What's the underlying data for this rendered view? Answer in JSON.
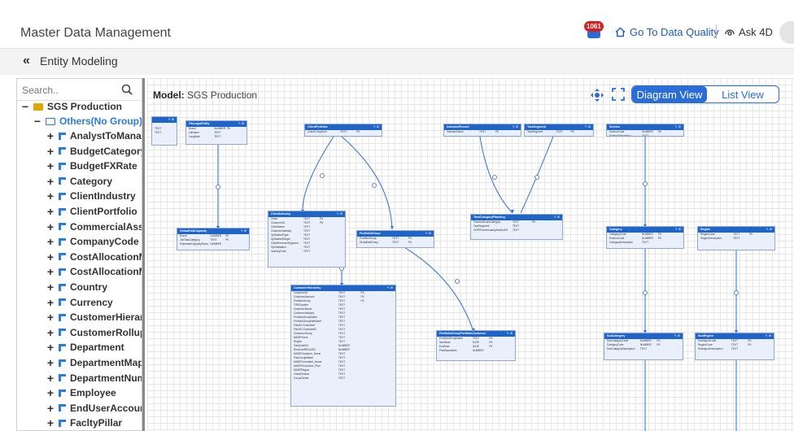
{
  "header": {
    "app_title": "Master Data Management",
    "notification_count": "1061",
    "data_quality_link": "Go To Data Quality",
    "ask_label": "Ask 4D"
  },
  "subheader": {
    "back_icon": "«",
    "title": "Entity Modeling"
  },
  "sidebar": {
    "search_placeholder": "Search..",
    "root_label": "SGS Production",
    "group_label": "Others(No Group)",
    "items": [
      "AnalystToManag",
      "BudgetCategory",
      "BudgetFXRate",
      "Category",
      "ClientIndustry",
      "ClientPortfolio",
      "CommercialAssi",
      "CompanyCode",
      "CostAllocationM",
      "CostAllocationM",
      "Country",
      "Currency",
      "CustomerHierar",
      "CustomerRollup",
      "Department",
      "DepartmentMap",
      "DepartmentNum",
      "Employee",
      "EndUserAccount",
      "FacltyPillar"
    ]
  },
  "canvas": {
    "model_prefix": "Model:",
    "model_name": "SGS Production",
    "view_active": "Diagram View",
    "view_inactive": "List View",
    "tables": [
      {
        "title": "",
        "rows": [
          [
            "",
            "",
            ""
          ],
          [
            "TEXT",
            "",
            ""
          ],
          [
            "TEXT",
            "",
            ""
          ]
        ]
      },
      {
        "title": "GfsLegalEntity",
        "rows": [
          [
            "Brand",
            "NUMBER",
            "PK"
          ],
          [
            "LatName",
            "TEXT",
            ""
          ],
          [
            "Longitude",
            "TEXT",
            ""
          ]
        ]
      },
      {
        "title": "ClientPortfolio",
        "rows": [
          [
            "ClientGroupNum",
            "TEXT",
            "PK"
          ],
          [
            "",
            "",
            ""
          ]
        ]
      },
      {
        "title": "IndicatorRecord",
        "rows": [
          [
            "IndicatorName",
            "TEXT",
            "PK"
          ],
          [
            "",
            "",
            ""
          ]
        ]
      },
      {
        "title": "TaskSegment",
        "rows": [
          [
            "TaskSegment",
            "TEXT",
            "PK"
          ],
          [
            "",
            "",
            ""
          ]
        ]
      },
      {
        "title": "Section",
        "rows": [
          [
            "SectionCode",
            "NUMBER",
            "PK"
          ],
          [
            "SectionDescription",
            "TEXT",
            ""
          ]
        ]
      },
      {
        "title": "GlobalHubCapacity",
        "rows": [
          [
            "Brand",
            "NUMBER",
            "PK"
          ],
          [
            "JobTaskCategory",
            "TEXT",
            "PK"
          ],
          [
            "EstimatedCapacityHours",
            "NUMBER",
            ""
          ]
        ]
      },
      {
        "title": "ClientIndustry",
        "rows": [
          [
            "Client",
            "TEXT",
            "PK"
          ],
          [
            "CustomerID",
            "TEXT",
            "PK"
          ],
          [
            "ClientName",
            "TEXT",
            ""
          ],
          [
            "CustomerIndustry",
            "TEXT",
            ""
          ],
          [
            "GpiMarketType",
            "TEXT",
            ""
          ],
          [
            "GpiMarketTarget",
            "TEXT",
            ""
          ],
          [
            "ClientRevenueSegment",
            "TEXT",
            ""
          ],
          [
            "GpiValidation",
            "TEXT",
            ""
          ],
          [
            "IndustryCode",
            "TEXT",
            ""
          ]
        ]
      },
      {
        "title": "PortfolioGroup",
        "rows": [
          [
            "PortfolioGroup",
            "TEXT",
            "PK"
          ],
          [
            "GlobalNetGroup",
            "TEXT",
            "PK"
          ]
        ]
      },
      {
        "title": "TaskCategoryPlanning",
        "rows": [
          [
            "PlannedHoursCategory",
            "TEXT",
            "PK"
          ],
          [
            "TaskSegment",
            "TEXT",
            ""
          ],
          [
            "OOPPredominantlyAndAsGM",
            "TEXT",
            ""
          ]
        ]
      },
      {
        "title": "Category",
        "rows": [
          [
            "CategoryCode",
            "NUMBER",
            "PK"
          ],
          [
            "SectionCode",
            "NUMBER",
            "PK"
          ],
          [
            "CategoryDescription",
            "TEXT",
            ""
          ]
        ]
      },
      {
        "title": "Region",
        "rows": [
          [
            "RegionCode",
            "TEXT",
            "PK"
          ],
          [
            "RegionDescription",
            "TEXT",
            ""
          ]
        ]
      },
      {
        "title": "CustomerHierarchy",
        "rows": [
          [
            "CustomerID",
            "TEXT",
            "PK"
          ],
          [
            "CustomerAccount",
            "TEXT",
            "PK"
          ],
          [
            "PortfolioGroup",
            "TEXT",
            "PK"
          ],
          [
            "TIRESystem",
            "TEXT",
            ""
          ],
          [
            "CustomerName",
            "TEXT",
            ""
          ],
          [
            "CustomerIndustry",
            "TEXT",
            ""
          ],
          [
            "PortfolioGroupName",
            "TEXT",
            ""
          ],
          [
            "PortfolioGroupNetName",
            "TEXT",
            ""
          ],
          [
            "FieldGCCostsheet",
            "TEXT",
            ""
          ],
          [
            "FieldGCCostsheet2",
            "TEXT",
            ""
          ],
          [
            "CustomerGroup",
            "TEXT",
            ""
          ],
          [
            "MADPClient",
            "TEXT",
            ""
          ],
          [
            "Region",
            "TEXT",
            ""
          ],
          [
            "TotalCostNO",
            "NUMBER",
            ""
          ],
          [
            "RevenueRDGUSD",
            "NUMBER",
            ""
          ],
          [
            "MADPCustomer_Name",
            "TEXT",
            ""
          ],
          [
            "PlanGroupMatch",
            "TEXT",
            ""
          ],
          [
            "MADPCorrelated_Name",
            "TEXT",
            ""
          ],
          [
            "MADPProduction_Plan",
            "TEXT",
            ""
          ],
          [
            "MADPRegion",
            "TEXT",
            ""
          ],
          [
            "ClientDivision",
            "TEXT",
            ""
          ],
          [
            "CompCluster",
            "TEXT",
            ""
          ]
        ]
      },
      {
        "title": "PortfolioGroupPortfolioCustomer",
        "rows": [
          [
            "PortfolioGroupName",
            "TEXT",
            "PK"
          ],
          [
            "StartDate",
            "DATE",
            "PK"
          ],
          [
            "EndDate",
            "DATE",
            "PK"
          ],
          [
            "PlanEquivalent",
            "NUMBER",
            ""
          ]
        ]
      },
      {
        "title": "SubCategory",
        "rows": [
          [
            "SubCategoryCode",
            "NUMBER",
            "PK"
          ],
          [
            "CategoryCode",
            "NUMBER",
            "PK"
          ],
          [
            "SubCategoryDescription",
            "TEXT",
            ""
          ]
        ]
      },
      {
        "title": "SubRegion",
        "rows": [
          [
            "SubregionCode",
            "TEXT",
            "PK"
          ],
          [
            "RegionCode",
            "TEXT",
            "PK"
          ],
          [
            "SubregionDescription",
            "TEXT",
            ""
          ]
        ]
      }
    ]
  },
  "icons": {
    "notification": "bell-icon",
    "home": "home-icon",
    "ask": "assistant-icon",
    "search": "search-icon",
    "move": "move-icon",
    "expand": "fullscreen-icon"
  },
  "colors": {
    "accent": "#2a6dd8",
    "table_header": "#1f64c8",
    "badge": "#d62020",
    "group_folder": "#2a7be0",
    "root_folder": "#e0a500"
  }
}
